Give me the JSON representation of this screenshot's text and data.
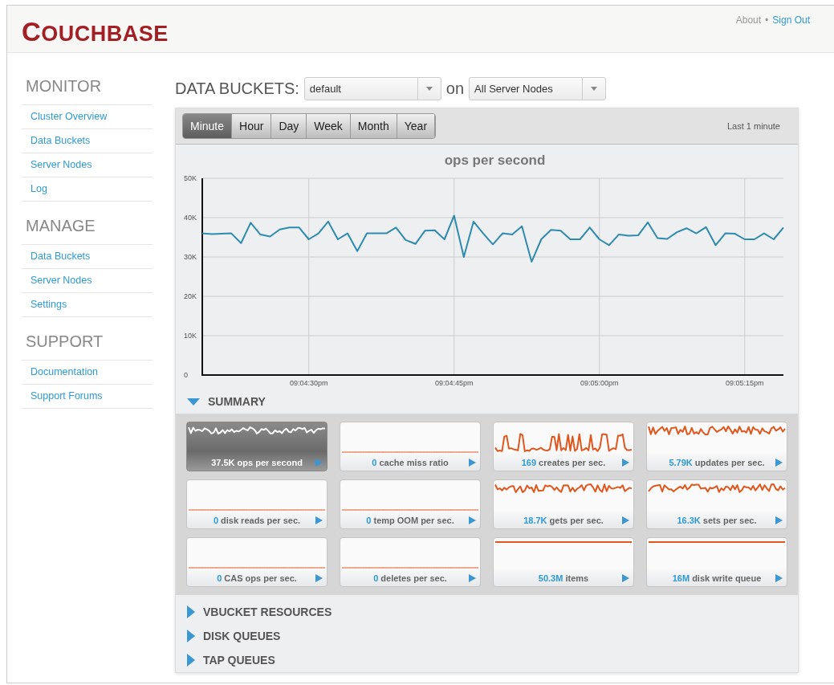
{
  "header": {
    "logo": "COUCHBASE",
    "links": [
      {
        "label": "About",
        "kind": "plain"
      },
      {
        "label": "•",
        "kind": "sep"
      },
      {
        "label": "Sign Out",
        "kind": "link"
      }
    ]
  },
  "sidebar": [
    {
      "title": "MONITOR",
      "items": [
        "Cluster Overview",
        "Data Buckets",
        "Server Nodes",
        "Log"
      ]
    },
    {
      "title": "MANAGE",
      "items": [
        "Data Buckets",
        "Server Nodes",
        "Settings"
      ]
    },
    {
      "title": "SUPPORT",
      "items": [
        "Documentation",
        "Support Forums"
      ]
    }
  ],
  "toolbar": {
    "label": "DATA BUCKETS:",
    "bucket": "default",
    "on": "on",
    "nodes": "All Server Nodes"
  },
  "tabs": [
    {
      "label": "Minute",
      "selected": true
    },
    {
      "label": "Hour",
      "selected": false
    },
    {
      "label": "Day",
      "selected": false
    },
    {
      "label": "Week",
      "selected": false
    },
    {
      "label": "Month",
      "selected": false
    },
    {
      "label": "Year",
      "selected": false
    }
  ],
  "range_label": "Last 1 minute",
  "chart_data": {
    "type": "line",
    "title": "ops per second",
    "categories": [
      null,
      null,
      null,
      null,
      null,
      null,
      null,
      null,
      null,
      null,
      null,
      "09:04:30pm",
      null,
      null,
      null,
      null,
      null,
      null,
      null,
      null,
      null,
      null,
      null,
      null,
      null,
      null,
      "09:04:45pm",
      null,
      null,
      null,
      null,
      null,
      null,
      null,
      null,
      null,
      null,
      null,
      null,
      null,
      null,
      "09:05:00pm",
      null,
      null,
      null,
      null,
      null,
      null,
      null,
      null,
      null,
      null,
      null,
      null,
      null,
      null,
      "09:05:15pm",
      null,
      null,
      null,
      null
    ],
    "series": [
      {
        "color": "#2e8bb0",
        "values": [
          36000,
          35800,
          35900,
          36000,
          33500,
          38700,
          35700,
          35200,
          37000,
          37500,
          37500,
          34500,
          36000,
          39000,
          34500,
          36000,
          31500,
          36000,
          36000,
          36000,
          37500,
          34300,
          33300,
          36700,
          36800,
          34500,
          40500,
          30000,
          39000,
          36000,
          33200,
          36000,
          35700,
          37800,
          28800,
          34500,
          36900,
          36700,
          34500,
          34500,
          37500,
          34500,
          33000,
          35700,
          35400,
          35500,
          38800,
          34800,
          34600,
          36300,
          37300,
          36000,
          37600,
          33000,
          36000,
          35900,
          34500,
          34500,
          36000,
          34500,
          37500
        ]
      }
    ],
    "ylim": [
      0,
      50000
    ],
    "grid": true,
    "yticks": [
      {
        "value": 0,
        "label": "0"
      },
      {
        "value": 10000,
        "label": "10K"
      },
      {
        "value": 20000,
        "label": "20K"
      },
      {
        "value": 30000,
        "label": "30K"
      },
      {
        "value": 40000,
        "label": "40K"
      },
      {
        "value": 50000,
        "label": "50K"
      }
    ]
  },
  "sections": [
    {
      "title": "SUMMARY",
      "expanded": true
    },
    {
      "title": "VBUCKET RESOURCES",
      "expanded": false
    },
    {
      "title": "DISK QUEUES",
      "expanded": false
    },
    {
      "title": "TAP QUEUES",
      "expanded": false
    }
  ],
  "tiles": [
    {
      "value": "37.5K",
      "label": "ops per second",
      "kind": "noisy",
      "selected": true
    },
    {
      "value": "0",
      "label": "cache miss ratio",
      "kind": "flat",
      "selected": false
    },
    {
      "value": "169",
      "label": "creates per sec.",
      "kind": "spiky",
      "selected": false
    },
    {
      "value": "5.79K",
      "label": "updates per sec.",
      "kind": "noisy",
      "selected": false
    },
    {
      "value": "0",
      "label": "disk reads per sec.",
      "kind": "flat",
      "selected": false
    },
    {
      "value": "0",
      "label": "temp OOM per sec.",
      "kind": "flat",
      "selected": false
    },
    {
      "value": "18.7K",
      "label": "gets per sec.",
      "kind": "noisy",
      "selected": false
    },
    {
      "value": "16.3K",
      "label": "sets per sec.",
      "kind": "noisy",
      "selected": false
    },
    {
      "value": "0",
      "label": "CAS ops per sec.",
      "kind": "flat",
      "selected": false
    },
    {
      "value": "0",
      "label": "deletes per sec.",
      "kind": "flat",
      "selected": false
    },
    {
      "value": "50.3M",
      "label": "items",
      "kind": "high",
      "selected": false
    },
    {
      "value": "16M",
      "label": "disk write queue",
      "kind": "high",
      "selected": false
    }
  ]
}
